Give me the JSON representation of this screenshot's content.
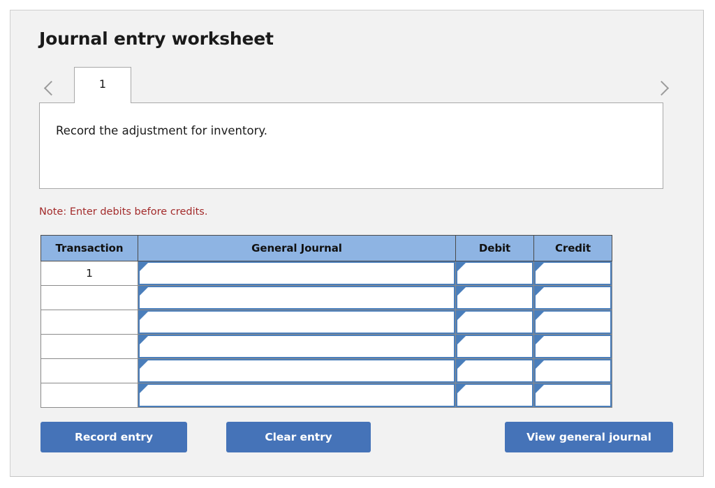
{
  "worksheet": {
    "title": "Journal entry worksheet",
    "note": "Note: Enter debits before credits.",
    "description": "Record the adjustment for inventory.",
    "prev_icon": "chevron-left-icon",
    "next_icon": "chevron-right-icon",
    "tabs": [
      {
        "label": "1",
        "active": true
      }
    ]
  },
  "table": {
    "columns": [
      "Transaction",
      "General Journal",
      "Debit",
      "Credit"
    ],
    "rows": [
      {
        "transaction": "1",
        "general_journal": "",
        "debit": "",
        "credit": ""
      },
      {
        "transaction": "",
        "general_journal": "",
        "debit": "",
        "credit": ""
      },
      {
        "transaction": "",
        "general_journal": "",
        "debit": "",
        "credit": ""
      },
      {
        "transaction": "",
        "general_journal": "",
        "debit": "",
        "credit": ""
      },
      {
        "transaction": "",
        "general_journal": "",
        "debit": "",
        "credit": ""
      },
      {
        "transaction": "",
        "general_journal": "",
        "debit": "",
        "credit": ""
      }
    ]
  },
  "buttons": {
    "record_entry": "Record entry",
    "clear_entry": "Clear entry",
    "view_general_journal": "View general journal"
  },
  "colors": {
    "button_blue": "#4573b8",
    "header_blue": "#8eb4e3",
    "field_border_blue": "#4a7ebb",
    "note_red": "#a32b2b",
    "panel_background": "#f2f2f2"
  }
}
